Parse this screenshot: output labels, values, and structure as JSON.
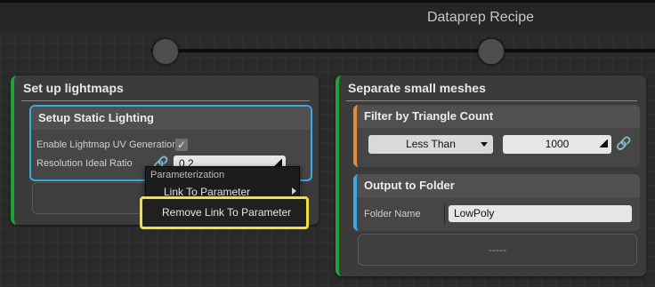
{
  "header": {
    "title": "Dataprep Recipe"
  },
  "steps": [
    {
      "title": "Set up lightmaps",
      "operation": {
        "title": "Setup Static Lighting",
        "params": [
          {
            "label": "Enable Lightmap UV Generation",
            "checked": true
          },
          {
            "label": "Resolution Ideal Ratio",
            "value": "0.2"
          }
        ]
      }
    },
    {
      "title": "Separate small meshes",
      "filter": {
        "title": "Filter by Triangle Count",
        "dropdown_value": "Less Than",
        "count_value": "1000"
      },
      "output": {
        "title": "Output to Folder",
        "folder_label": "Folder Name",
        "folder_value": "LowPoly"
      },
      "empty_slot": "-----"
    }
  ],
  "context_menu": {
    "header": "Parameterization",
    "items": [
      "Link To Parameter",
      "Remove Link To Parameter"
    ]
  },
  "colors": {
    "step_accent": "#23a137",
    "operation_accent": "#3ca8e0",
    "filter_accent": "#e08c3c",
    "link_icon": "#55c94c",
    "highlight": "#f2e03a"
  },
  "icons": [
    "link-icon",
    "checkmark-icon",
    "dropdown-arrow-icon",
    "submenu-arrow-icon",
    "resize-corner-icon"
  ]
}
